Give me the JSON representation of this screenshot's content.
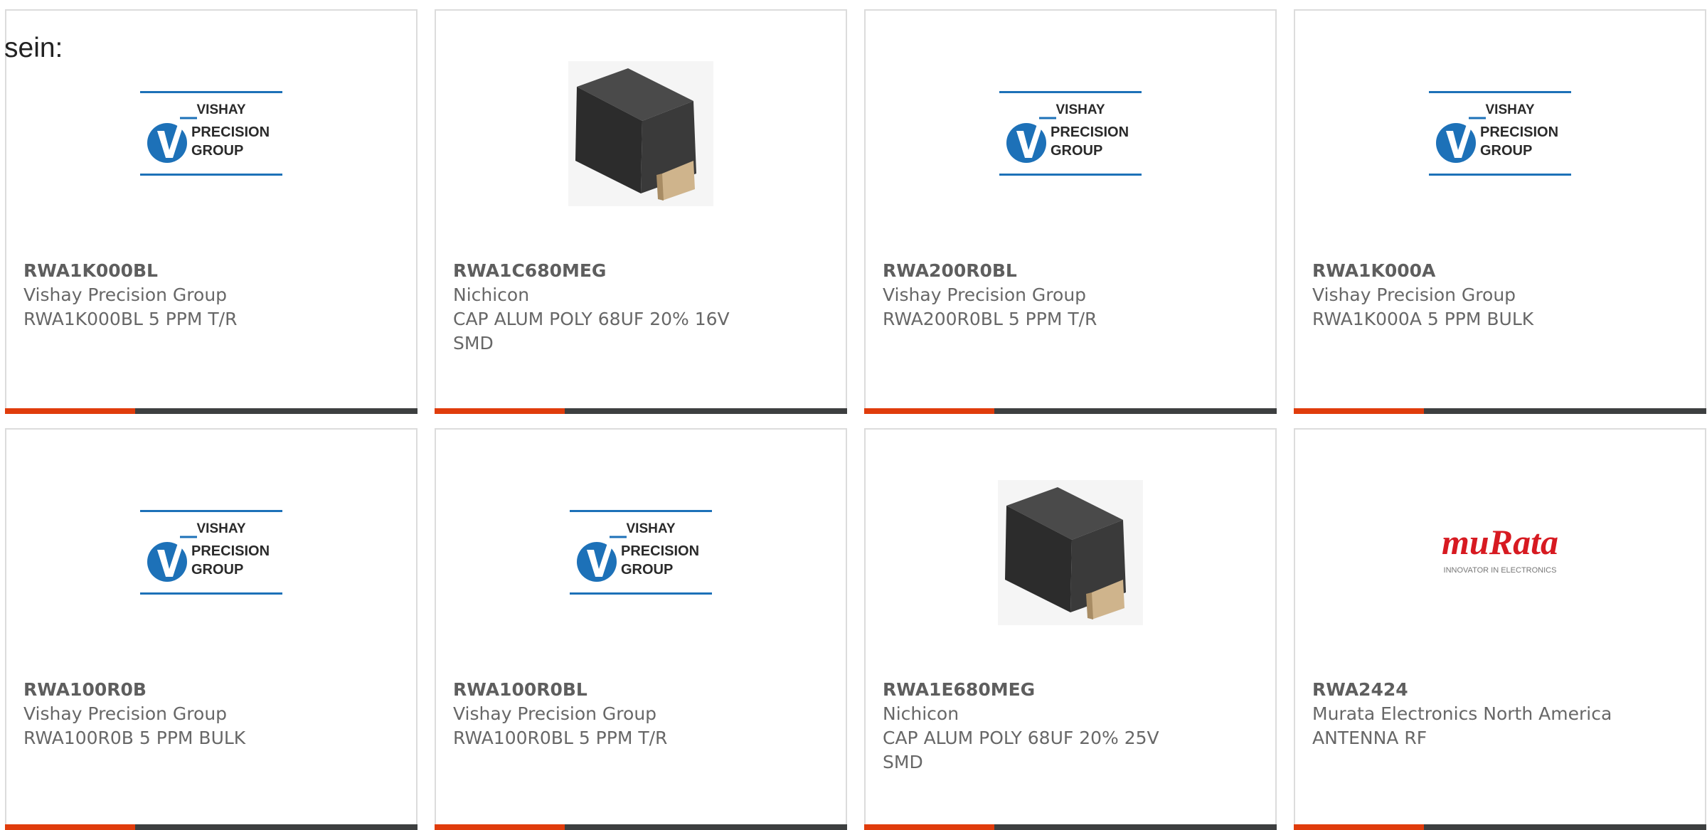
{
  "intro_text": "sein:",
  "colors": {
    "accent": "#e03c0c",
    "bar": "#3d3f40",
    "vishay_blue": "#1d71b8",
    "murata_red": "#d71a21"
  },
  "products": [
    {
      "part_number": "RWA1K000BL",
      "manufacturer": "Vishay Precision Group",
      "description": "RWA1K000BL 5 PPM T/R",
      "image": "vishay-logo",
      "logo_text": {
        "line1": "VISHAY",
        "line2": "PRECISION",
        "line3": "GROUP"
      }
    },
    {
      "part_number": "RWA1C680MEG",
      "manufacturer": "Nichicon",
      "description": "CAP ALUM POLY 68UF 20% 16V SMD",
      "image": "capacitor-photo"
    },
    {
      "part_number": "RWA200R0BL",
      "manufacturer": "Vishay Precision Group",
      "description": "RWA200R0BL 5 PPM T/R",
      "image": "vishay-logo",
      "logo_text": {
        "line1": "VISHAY",
        "line2": "PRECISION",
        "line3": "GROUP"
      }
    },
    {
      "part_number": "RWA1K000A",
      "manufacturer": "Vishay Precision Group",
      "description": "RWA1K000A 5 PPM BULK",
      "image": "vishay-logo",
      "logo_text": {
        "line1": "VISHAY",
        "line2": "PRECISION",
        "line3": "GROUP"
      }
    },
    {
      "part_number": "RWA100R0B",
      "manufacturer": "Vishay Precision Group",
      "description": "RWA100R0B 5 PPM BULK",
      "image": "vishay-logo",
      "logo_text": {
        "line1": "VISHAY",
        "line2": "PRECISION",
        "line3": "GROUP"
      }
    },
    {
      "part_number": "RWA100R0BL",
      "manufacturer": "Vishay Precision Group",
      "description": "RWA100R0BL 5 PPM T/R",
      "image": "vishay-logo",
      "logo_text": {
        "line1": "VISHAY",
        "line2": "PRECISION",
        "line3": "GROUP"
      }
    },
    {
      "part_number": "RWA1E680MEG",
      "manufacturer": "Nichicon",
      "description": "CAP ALUM POLY 68UF 20% 25V SMD",
      "image": "capacitor-photo"
    },
    {
      "part_number": "RWA2424",
      "manufacturer": "Murata Electronics North America",
      "description": "ANTENNA RF",
      "image": "murata-logo",
      "logo_text": {
        "brand": "muRata",
        "tagline": "INNOVATOR IN ELECTRONICS"
      }
    }
  ]
}
